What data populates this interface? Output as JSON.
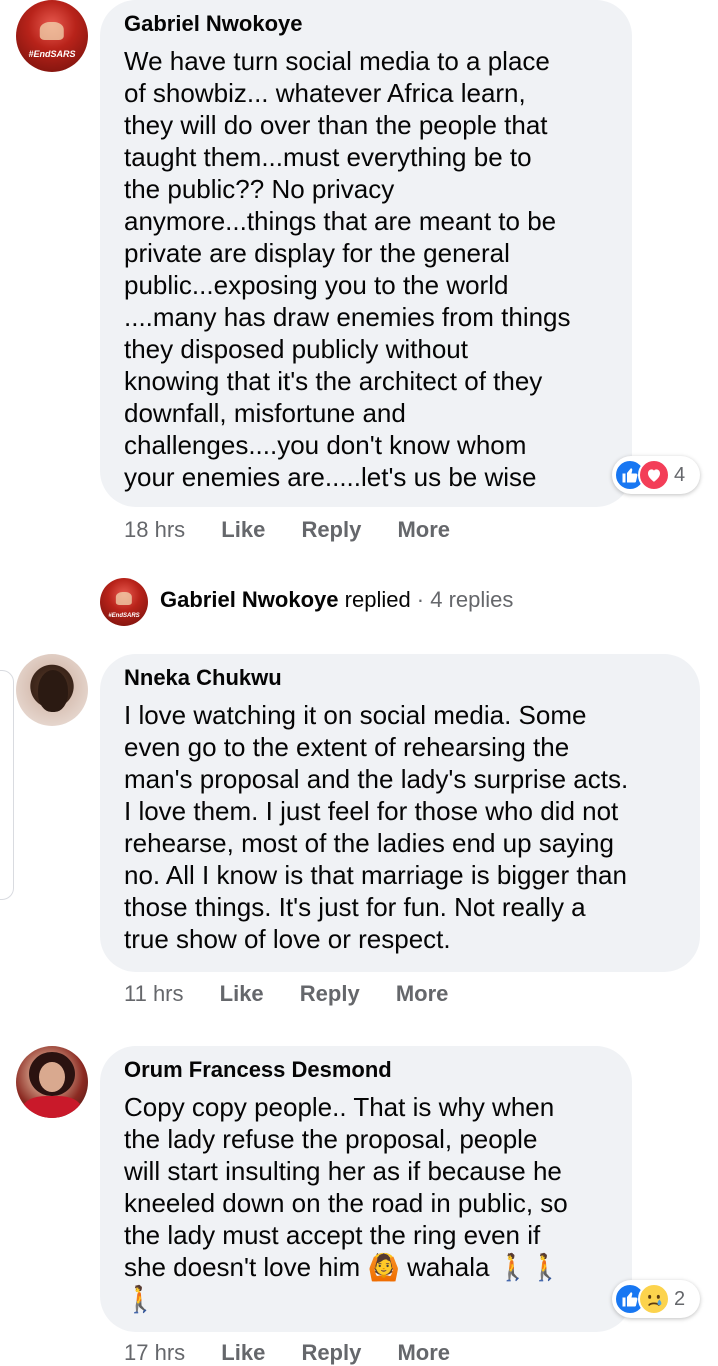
{
  "comments": [
    {
      "author": "Gabriel Nwokoye",
      "avatar_label": "#EndSARS",
      "text": "We have turn social media to a place\nof showbiz... whatever Africa learn,\nthey will do over than the people that\ntaught them...must everything be to\nthe public?? No privacy\nanymore...things that are meant to be\nprivate are display for the general\npublic...exposing you to the world\n....many has draw enemies from things\nthey disposed publicly without\nknowing that it's the architect of they\ndownfall, misfortune and\nchallenges....you don't know whom\nyour enemies are.....let's us be wise",
      "time": "18 hrs",
      "like_label": "Like",
      "reply_label": "Reply",
      "more_label": "More",
      "reaction_icons": [
        "like-icon",
        "love-icon"
      ],
      "reaction_count": "4"
    },
    {
      "author": "Nneka Chukwu",
      "text": "I love watching it on social media. Some\neven go to the extent of rehearsing the\nman's proposal and the lady's surprise acts.\nI love them. I just feel for those who did not\nrehearse, most of the ladies end up saying\nno. All I know is that marriage is bigger than\nthose things. It's just for fun. Not really a\ntrue show of love or respect.",
      "time": "11 hrs",
      "like_label": "Like",
      "reply_label": "Reply",
      "more_label": "More"
    },
    {
      "author": "Orum Francess Desmond",
      "text_line1": "Copy copy people.. That is why when\nthe lady refuse the proposal, people\nwill start insulting her as if because he\nkneeled down on the road in public, so\nthe lady must accept the ring even if\nshe doesn't love him",
      "emoji_1": "🙆",
      "text_word": "wahala",
      "emoji_walk": "🚶",
      "time": "17 hrs",
      "like_label": "Like",
      "reply_label": "Reply",
      "more_label": "More",
      "reaction_icons": [
        "like-icon",
        "sad-icon"
      ],
      "reaction_count": "2"
    }
  ],
  "reply_summary": {
    "author": "Gabriel Nwokoye",
    "avatar_label": "#EndSARS",
    "verb": "replied",
    "separator": " · ",
    "count": "4 replies"
  },
  "colors": {
    "bubble": "#f0f2f5",
    "meta_text": "#65676b",
    "like_blue": "#1877f2",
    "love_red": "#f33e58",
    "sad_yellow": "#fcd34d"
  }
}
